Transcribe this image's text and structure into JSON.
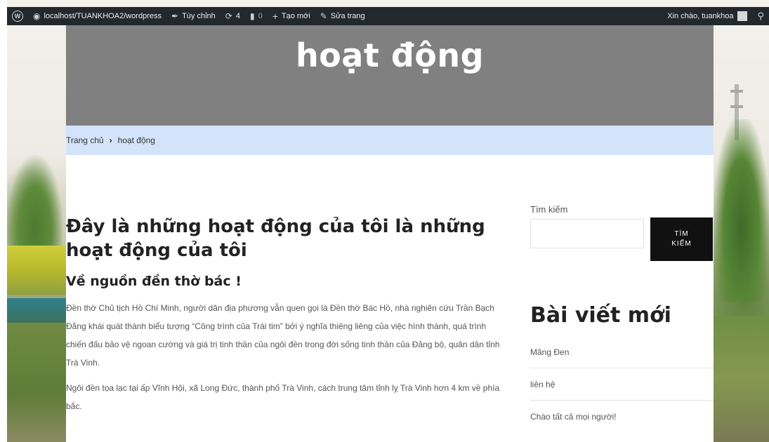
{
  "adminbar": {
    "site_url": "localhost/TUANKHOA2/wordpress",
    "customize": "Tùy chỉnh",
    "updates_count": "4",
    "comments_count": "0",
    "new_label": "Tạo mới",
    "edit_page": "Sửa trang",
    "greeting": "Xin chào, tuankhoa"
  },
  "hero": {
    "title": "hoạt động"
  },
  "breadcrumb": {
    "home": "Trang chủ",
    "current": "hoạt động"
  },
  "article": {
    "heading": "Đây là những hoạt động của tôi là những hoạt động của tôi",
    "subheading": "Về nguồn đền thờ bác !",
    "paragraphs": [
      "Đền thờ Chủ tịch Hồ Chí Minh, người dân địa phương vẫn quen gọi là Đền thờ Bác Hồ, nhà nghiên cứu Trần Bạch Đằng khái quát thành biểu tượng “Công trình của Trái tim” bởi ý nghĩa thiêng liêng của việc hình thành, quá trình chiến đấu bảo vệ ngoan cường và giá trị tinh thần của ngôi đền trong đời sống tinh thần của Đảng bộ, quân dân tỉnh Trà Vinh.",
      "Ngôi đền tọa lạc tại ấp Vĩnh Hội, xã Long Đức, thành phố Trà Vinh, cách trung tâm tỉnh lỵ Trà Vinh hơn 4 km về phía bắc."
    ]
  },
  "sidebar": {
    "search_label": "Tìm kiếm",
    "search_placeholder": "",
    "search_button": "TÌM KIẾM",
    "recent_title": "Bài viết mới",
    "recent_posts": [
      "Măng Đen",
      "liên hệ",
      "Chào tất cả mọi người!"
    ]
  },
  "icons": {
    "wp": "wordpress-icon",
    "dashboard": "dashboard-icon",
    "customize": "brush-icon",
    "updates": "refresh-icon",
    "comments": "comment-icon",
    "new": "plus-icon",
    "edit": "pencil-icon",
    "search": "search-icon"
  },
  "colors": {
    "adminbar_bg": "#23282d",
    "hero_bg": "#808080",
    "breadcrumb_bg": "#d3e4fa",
    "button_bg": "#111111"
  }
}
